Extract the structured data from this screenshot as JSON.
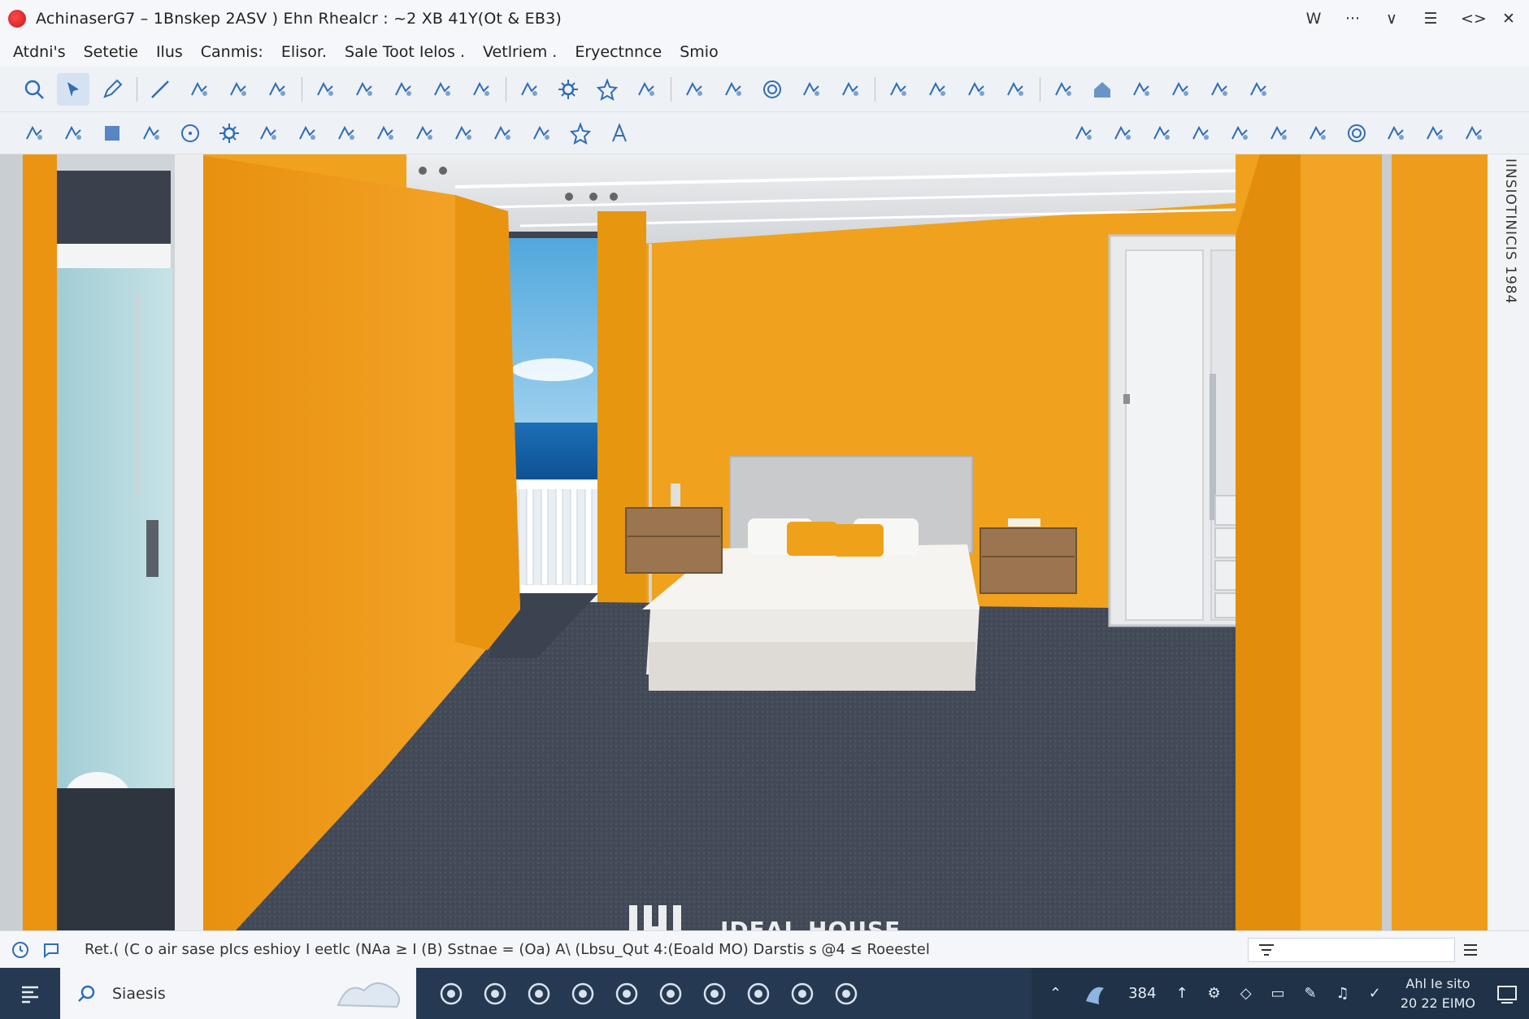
{
  "window": {
    "title": "AchinaserG7 – 1Bnskep 2ASV ) Ehn Rhealcr : ~2 XB 41Y(Ot & EB3)",
    "controls": [
      "W",
      "···",
      "∨",
      "☰",
      "<>",
      "✕"
    ]
  },
  "menu": [
    "Atdni's",
    "Setetie",
    "Ilus",
    "Canmis:",
    "Elisor.",
    "Sale Toot Ielos .",
    "Vetlriem .",
    "Eryectnnce",
    "Smio"
  ],
  "toolbar1": {
    "icons": [
      "zoom-icon",
      "select-icon",
      "pencil-icon",
      "line-icon",
      "polyline-icon",
      "box-icon",
      "shape-icon",
      "rotate-icon",
      "move-icon",
      "refresh-icon",
      "frame-icon",
      "roof-icon",
      "pin-icon",
      "gear-icon",
      "star-icon",
      "hand-icon",
      "magnify-icon",
      "cut-icon",
      "target-icon",
      "tools-icon",
      "pen-icon",
      "scissors-icon",
      "camera-icon",
      "stair-icon",
      "curtain-icon",
      "window-icon",
      "house-icon",
      "column-icon",
      "cabinet-icon",
      "wall-icon",
      "block-icon"
    ]
  },
  "toolbar2": {
    "icons": [
      "ruler-icon",
      "measure-icon",
      "square-icon",
      "hatch-icon",
      "circle-icon",
      "gear-icon",
      "spline-icon",
      "heart-icon",
      "arrow-icon",
      "section-icon",
      "lasso-icon",
      "cloud-icon",
      "pen-icon",
      "dimension-icon",
      "star-icon",
      "text-icon"
    ],
    "right_icons": [
      "move-icon",
      "brush-icon",
      "search-icon",
      "layer-icon",
      "cross-icon",
      "orbit-icon",
      "snap-icon",
      "target-icon",
      "person-icon",
      "panel-icon",
      "render-icon"
    ]
  },
  "side_panel": {
    "label": "IINSIOTINICIS 1984"
  },
  "status": {
    "text": "Ret.( (C o air sase pIcs eshioy I eetlc (NAa ≥ I (B) Sstnae = (Oa) A\\ (Lbsu_Qut 4:(Eoald MO) Darstis s @4 ≤ Roeestel",
    "search_value": ""
  },
  "watermark": "IDEAL HOUSE",
  "taskbar": {
    "search_text": "Siaesis",
    "tray_num": "384",
    "clock_top": "Ahl Ie sito",
    "clock_bottom": "20 22 EIMO"
  },
  "colors": {
    "wall": "#f0a21e",
    "floor": "#3f4654",
    "accent": "#2f6db5",
    "taskbar": "#253a52"
  }
}
